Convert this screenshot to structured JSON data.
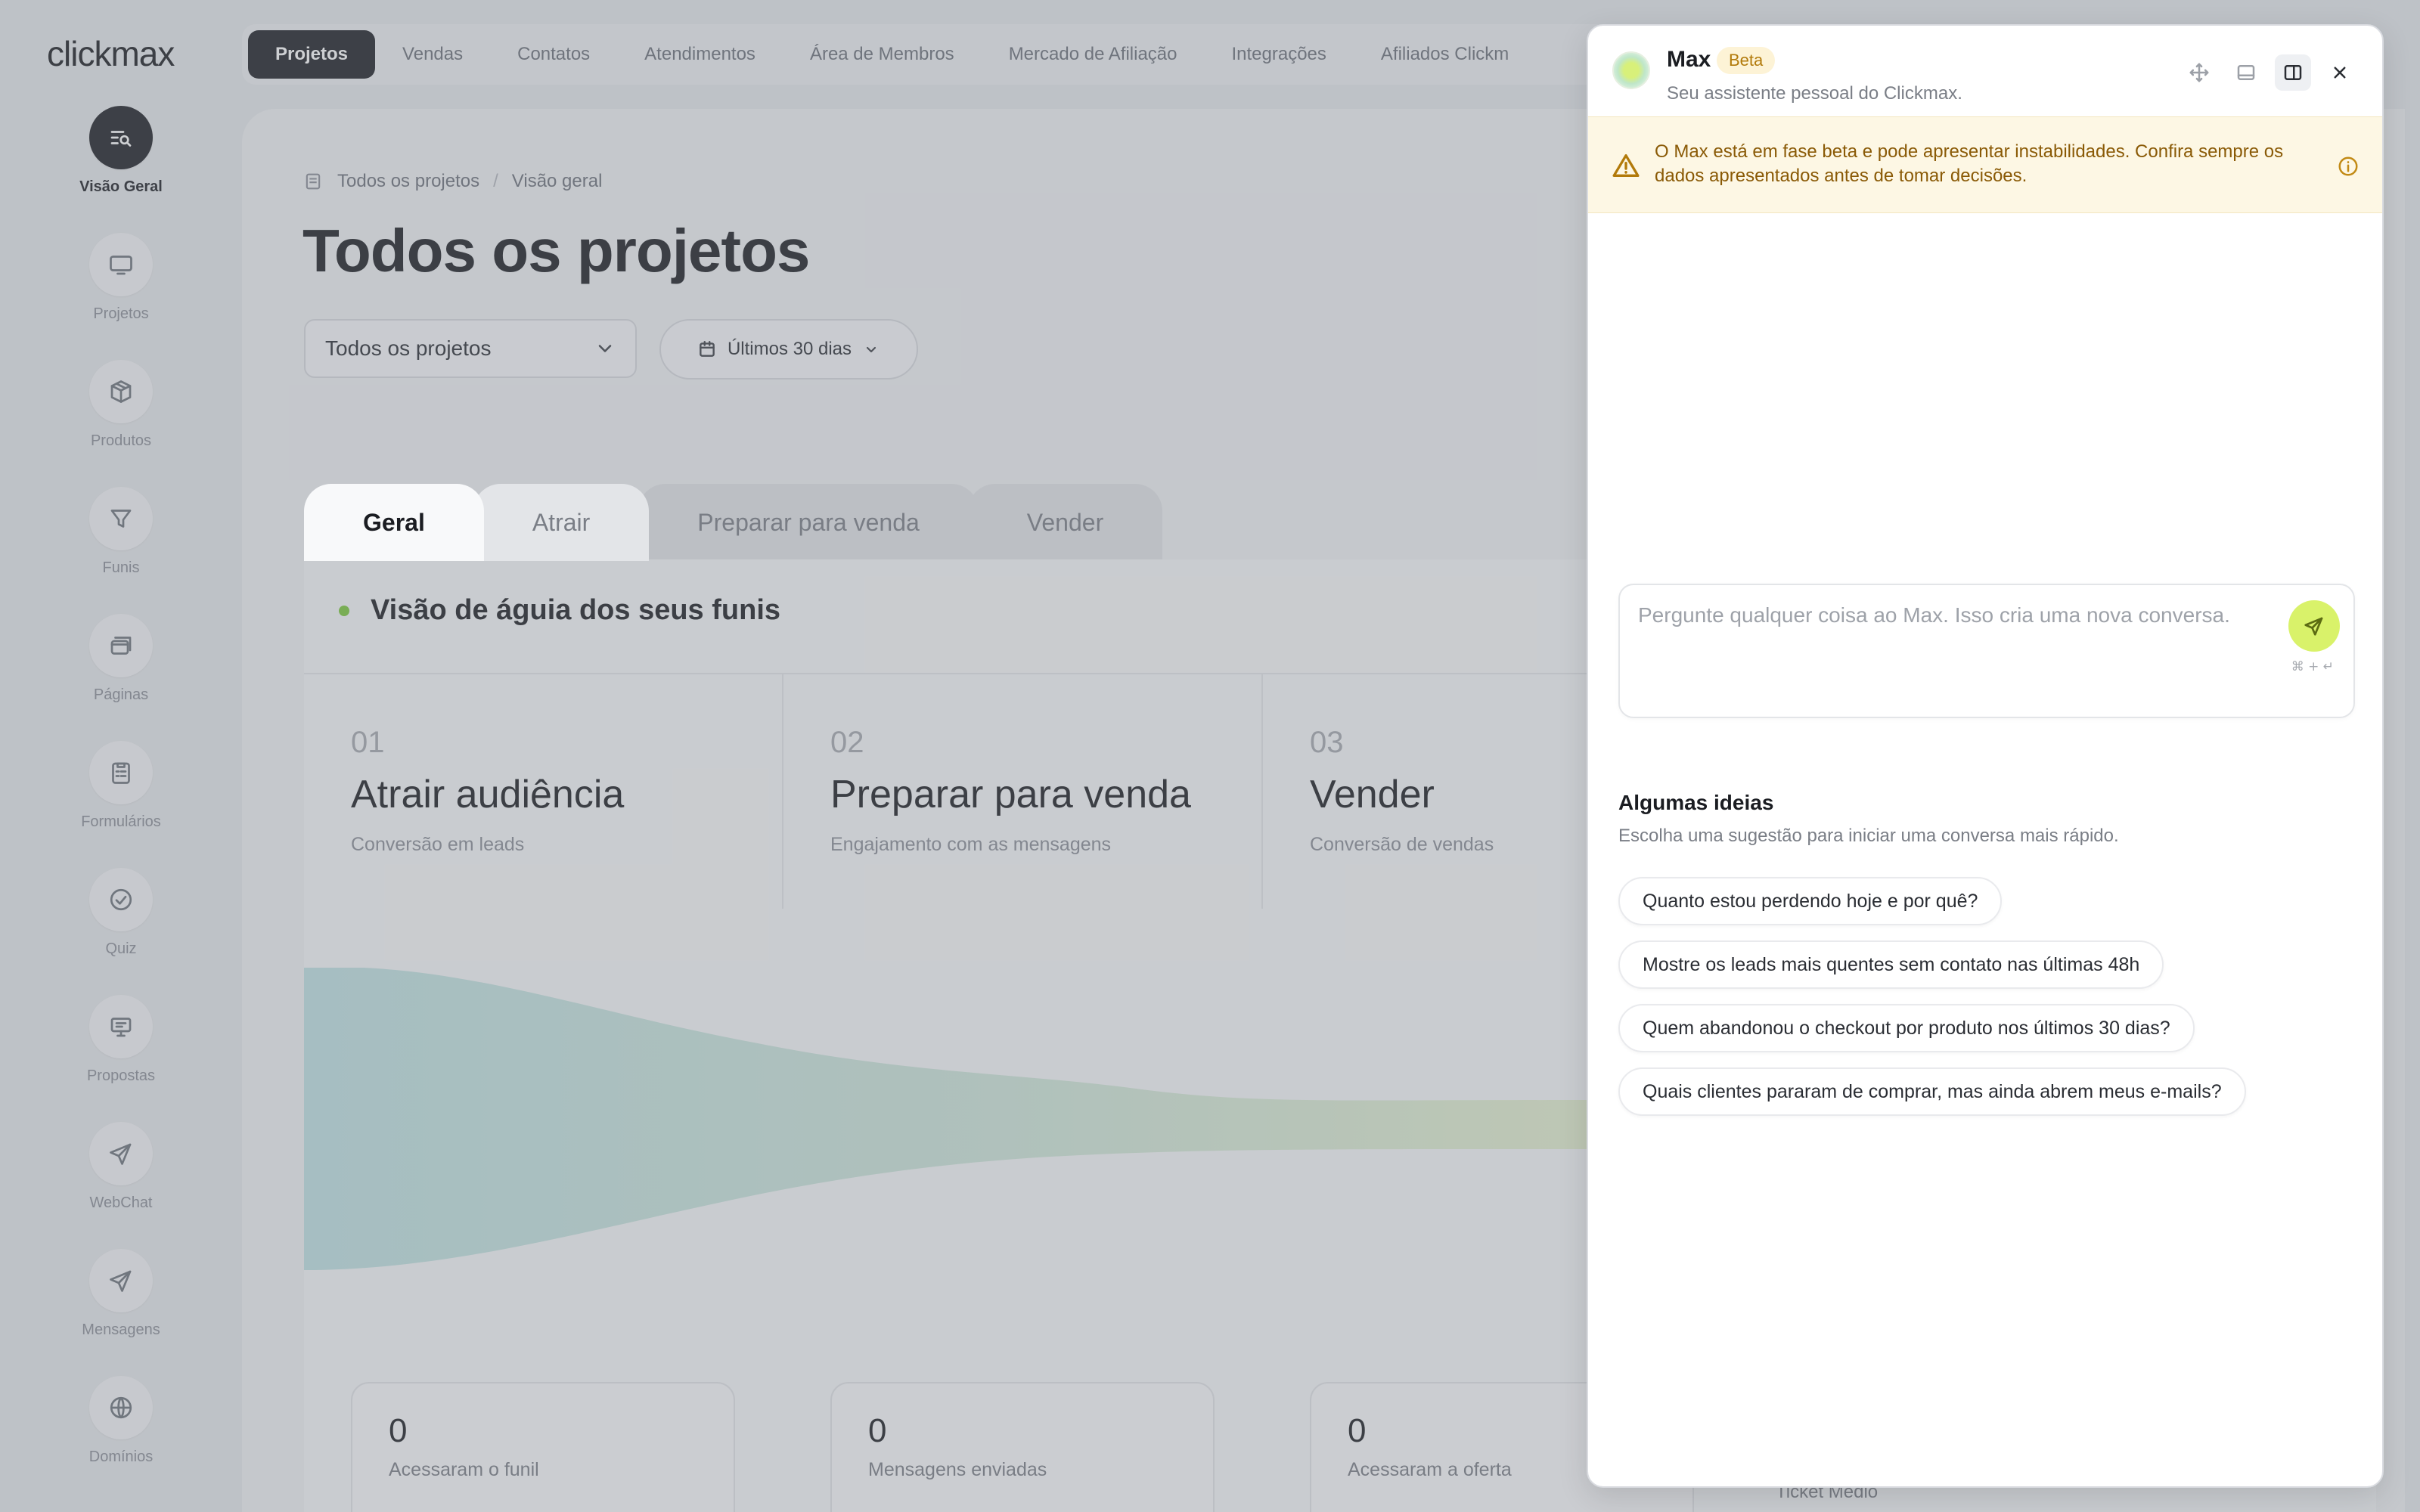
{
  "brand": {
    "logo": "clickmax"
  },
  "sidebar": {
    "items": [
      {
        "label": "Visão Geral",
        "icon": "search-list-icon",
        "active": true
      },
      {
        "label": "Projetos",
        "icon": "monitor-icon"
      },
      {
        "label": "Produtos",
        "icon": "box-icon"
      },
      {
        "label": "Funis",
        "icon": "filter-icon"
      },
      {
        "label": "Páginas",
        "icon": "pages-icon"
      },
      {
        "label": "Formulários",
        "icon": "clipboard-icon"
      },
      {
        "label": "Quiz",
        "icon": "check-circle-icon"
      },
      {
        "label": "Propostas",
        "icon": "presentation-icon"
      },
      {
        "label": "WebChat",
        "icon": "send-icon"
      },
      {
        "label": "Mensagens",
        "icon": "send-icon"
      },
      {
        "label": "Domínios",
        "icon": "globe-icon"
      }
    ]
  },
  "topnav": {
    "tabs": [
      {
        "label": "Projetos",
        "active": true
      },
      {
        "label": "Vendas"
      },
      {
        "label": "Contatos"
      },
      {
        "label": "Atendimentos"
      },
      {
        "label": "Área de Membros"
      },
      {
        "label": "Mercado de Afiliação"
      },
      {
        "label": "Integrações"
      },
      {
        "label": "Afiliados Clickm"
      }
    ]
  },
  "breadcrumb": {
    "root": "Todos os projetos",
    "separator": "/",
    "current": "Visão geral"
  },
  "page": {
    "title": "Todos os projetos"
  },
  "filters": {
    "project_select": "Todos os projetos",
    "date_range": "Últimos 30 dias"
  },
  "funnel_tabs": [
    "Geral",
    "Atrair",
    "Preparar para venda",
    "Vender"
  ],
  "funnel": {
    "heading": "Visão de águia dos seus funis",
    "stages": [
      {
        "num": "01",
        "name": "Atrair audiência",
        "sub": "Conversão em leads"
      },
      {
        "num": "02",
        "name": "Preparar para venda",
        "sub": "Engajamento com as mensagens"
      },
      {
        "num": "03",
        "name": "Vender",
        "sub": "Conversão de vendas"
      }
    ],
    "metrics": [
      {
        "value": "0",
        "label": "Acessaram o funil"
      },
      {
        "value": "0",
        "label": "Mensagens enviadas"
      },
      {
        "value": "0",
        "label": "Acessaram a oferta"
      }
    ],
    "ticket_label": "Ticket Médio"
  },
  "assistant": {
    "name": "Max",
    "badge": "Beta",
    "subtitle": "Seu assistente pessoal do Clickmax.",
    "warning": "O Max está em fase beta e pode apresentar instabilidades. Confira sempre os dados apresentados antes de tomar decisões.",
    "input_placeholder": "Pergunte qualquer coisa ao Max. Isso cria uma nova conversa.",
    "shortcut_hint": "⌘ + ↵",
    "ideas_title": "Algumas ideias",
    "ideas_subtitle": "Escolha uma sugestão para iniciar uma conversa mais rápido.",
    "suggestions": [
      "Quanto estou perdendo hoje e por quê?",
      "Mostre os leads mais quentes sem contato nas últimas 48h",
      "Quem abandonou o checkout por produto nos últimos 30 dias?",
      "Quais clientes pararam de comprar, mas ainda abrem meus e-mails?"
    ]
  },
  "colors": {
    "accent": "#d9f26a",
    "dark": "#1d1f24",
    "warning_bg": "#fdf7e4",
    "warning_text": "#8a5a06",
    "status_dot": "#7bc93a"
  }
}
